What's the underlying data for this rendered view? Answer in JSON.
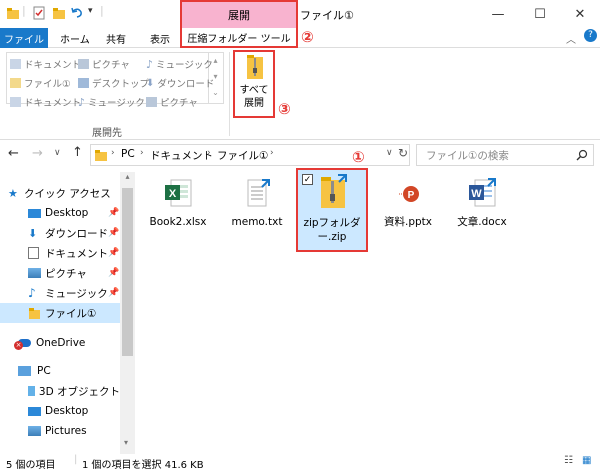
{
  "titlebar": {
    "title": "ファイル①",
    "context_group_label": "展開",
    "context_tab_label": "圧縮フォルダー ツール",
    "minimize_glyph": "—",
    "maximize_glyph": "☐",
    "close_glyph": "✕"
  },
  "tabs": {
    "file": "ファイル",
    "home": "ホーム",
    "share": "共有",
    "view": "表示",
    "help_glyph": "?"
  },
  "ribbon": {
    "gallery": [
      {
        "label": "ドキュメント",
        "icon": "document-folder-icon"
      },
      {
        "label": "ピクチャ",
        "icon": "pictures-folder-icon"
      },
      {
        "label": "ミュージック",
        "icon": "music-folder-icon"
      },
      {
        "label": "ファイル①",
        "icon": "folder-icon"
      },
      {
        "label": "デスクトップ",
        "icon": "desktop-folder-icon"
      },
      {
        "label": "ダウンロード",
        "icon": "download-folder-icon"
      },
      {
        "label": "ドキュメント",
        "icon": "document-folder-icon"
      },
      {
        "label": "ミュージック",
        "icon": "music-folder-icon"
      },
      {
        "label": "ピクチャ",
        "icon": "pictures-folder-icon"
      }
    ],
    "group_label": "展開先",
    "extract_all_line1": "すべて",
    "extract_all_line2": "展開"
  },
  "address": {
    "breadcrumb": [
      "PC",
      "ドキュメント",
      "ファイル①"
    ],
    "search_placeholder": "ファイル①の検索"
  },
  "nav": {
    "items": [
      {
        "label": "クイック アクセス",
        "icon": "star-icon",
        "pinned": false
      },
      {
        "label": "Desktop",
        "icon": "desktop-icon",
        "pinned": true
      },
      {
        "label": "ダウンロード",
        "icon": "download-icon",
        "pinned": true
      },
      {
        "label": "ドキュメント",
        "icon": "document-icon",
        "pinned": true
      },
      {
        "label": "ピクチャ",
        "icon": "pictures-icon",
        "pinned": true
      },
      {
        "label": "ミュージック",
        "icon": "music-icon",
        "pinned": true
      },
      {
        "label": "ファイル①",
        "icon": "folder-icon",
        "pinned": false,
        "selected": true
      },
      {
        "label": "OneDrive",
        "icon": "onedrive-icon",
        "pinned": false
      },
      {
        "label": "PC",
        "icon": "pc-icon",
        "pinned": false
      },
      {
        "label": "3D オブジェクト",
        "icon": "3d-objects-icon",
        "pinned": false
      },
      {
        "label": "Desktop",
        "icon": "desktop-icon",
        "pinned": false
      },
      {
        "label": "Pictures",
        "icon": "pictures-icon",
        "pinned": false
      }
    ]
  },
  "files": [
    {
      "name": "Book2.xlsx",
      "icon": "excel-file-icon"
    },
    {
      "name": "memo.txt",
      "icon": "text-file-icon"
    },
    {
      "name": "zipフォルダー.zip",
      "name_line1": "zipフォルダ",
      "name_line2": "ー.zip",
      "icon": "zip-folder-icon",
      "selected": true
    },
    {
      "name": "資料.pptx",
      "icon": "powerpoint-file-icon"
    },
    {
      "name": "文章.docx",
      "icon": "word-file-icon"
    }
  ],
  "status": {
    "count": "5 個の項目",
    "selection": "1 個の項目を選択  41.6 KB"
  },
  "annotations": {
    "mark1": "①",
    "mark2": "②",
    "mark3": "③"
  },
  "colors": {
    "accent": "#1979ca",
    "context_tab": "#f8b3cf",
    "highlight_box": "#e53935",
    "selection": "#cce8ff"
  }
}
